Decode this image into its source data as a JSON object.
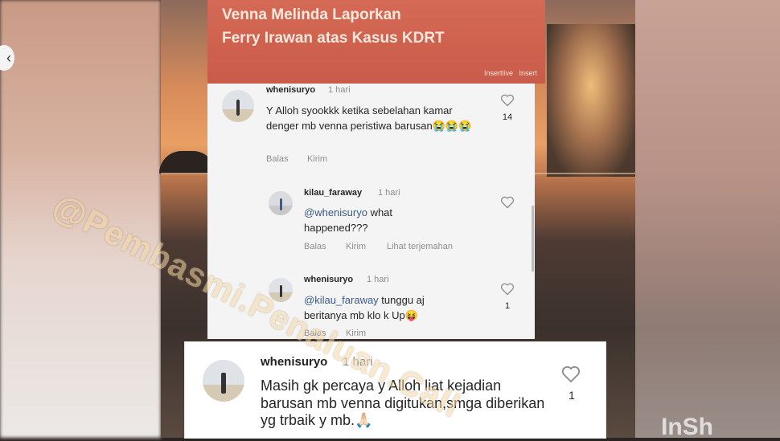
{
  "news": {
    "title_line1": "Venna Melinda Laporkan",
    "title_line2": "Ferry Irawan atas Kasus KDRT",
    "tag1": "Insertlive",
    "tag2": "Insert"
  },
  "comments": [
    {
      "username": "whenisuryo",
      "time": "1 hari",
      "text": "Y Alloh syookkk ketika sebelahan kamar denger mb venna peristiwa barusan😭😭😭",
      "likes": "14",
      "reply_label": "Balas",
      "send_label": "Kirim"
    },
    {
      "username": "kilau_faraway",
      "time": "1 hari",
      "mention": "@whenisuryo",
      "text": " what happened???",
      "reply_label": "Balas",
      "send_label": "Kirim",
      "translate_label": "Lihat terjemahan"
    },
    {
      "username": "whenisuryo",
      "time": "1 hari",
      "mention": "@kilau_faraway",
      "text": " tunggu aj beritanya mb klo k Up😝",
      "likes": "1",
      "reply_label": "Balas",
      "send_label": "Kirim"
    }
  ],
  "zoom_comment": {
    "username": "whenisuryo",
    "time": "1 hari",
    "text": "Masih gk percaya y Alloh liat kejadian barusan mb venna digitukan,smga diberikan yg trbaik y mb.🙏🏻",
    "likes": "1"
  },
  "watermark": "@Pembasmi.Penaluan.Call",
  "brand_corner": "InSh"
}
